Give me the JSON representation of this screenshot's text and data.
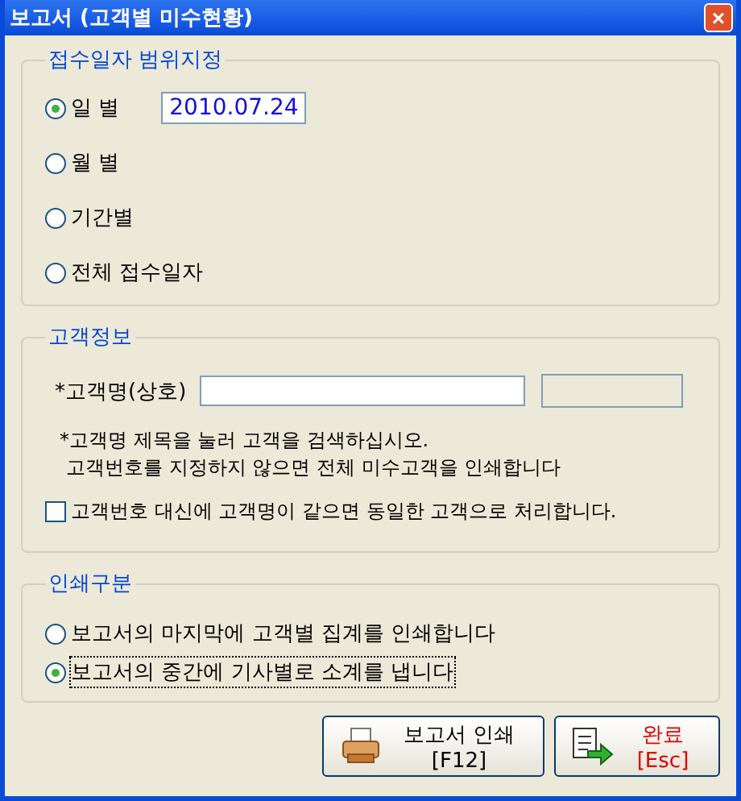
{
  "window": {
    "title": "보고서 (고객별 미수현황)",
    "close": "×"
  },
  "date_range": {
    "legend": "접수일자 범위지정",
    "options": [
      {
        "label": "일  별",
        "selected": true,
        "value": "2010.07.24"
      },
      {
        "label": "월  별",
        "selected": false
      },
      {
        "label": "기간별",
        "selected": false
      },
      {
        "label": "전체 접수일자",
        "selected": false
      }
    ]
  },
  "customer": {
    "legend": "고객정보",
    "name_label": "*고객명(상호)",
    "hint_lines": [
      "*고객명 제목을 눌러 고객을 검색하십시오.",
      "고객번호를 지정하지 않으면 전체 미수고객을 인쇄합니다"
    ],
    "same_name": {
      "label": "고객번호 대신에 고객명이 같으면 동일한 고객으로 처리합니다.",
      "checked": false
    }
  },
  "print_type": {
    "legend": "인쇄구분",
    "options": [
      {
        "label": "보고서의 마지막에 고객별 집계를 인쇄합니다",
        "selected": false
      },
      {
        "label": "보고서의 중간에 기사별로 소계를 냅니다",
        "selected": true
      }
    ]
  },
  "buttons": [
    {
      "kind": "print",
      "label": "보고서 인쇄[F12]"
    },
    {
      "kind": "done",
      "label": "완료[Esc]"
    }
  ]
}
